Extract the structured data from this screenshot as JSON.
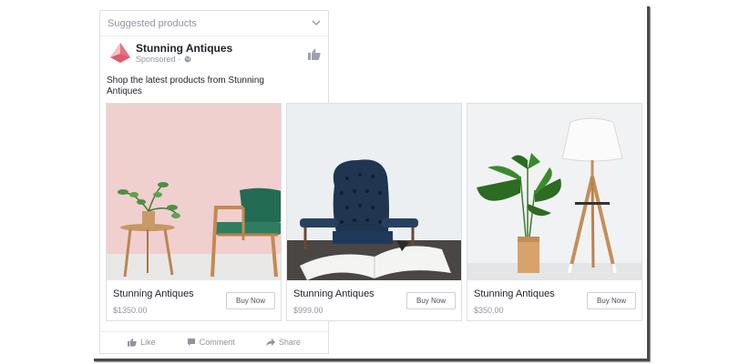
{
  "post": {
    "section_label": "Suggested products",
    "brand_name": "Stunning Antiques",
    "sponsored_label": "Sponsored",
    "meta_separator": "·",
    "body_text": "Shop the latest  products from Stunning Antiques"
  },
  "products": [
    {
      "title": "Stunning Antiques",
      "price": "$1350.00",
      "button": "Buy Now"
    },
    {
      "title": "Stunning Antiques",
      "price": "$999.00",
      "button": "Buy Now"
    },
    {
      "title": "Stunning Antiques",
      "price": "$350.00",
      "button": "Buy Now"
    }
  ],
  "actions": {
    "like": "Like",
    "comment": "Comment",
    "share": "Share"
  },
  "icons": {
    "chevron": "chevron-down-icon",
    "logo": "pyramid-logo",
    "globe": "globe-icon",
    "like_page": "thumbs-up-icon",
    "like": "thumbs-up-icon",
    "comment": "comment-icon",
    "share": "share-arrow-icon"
  },
  "colors": {
    "brand_logo": "#e9838d",
    "muted_text": "#90949c",
    "border": "#dddfe2"
  }
}
